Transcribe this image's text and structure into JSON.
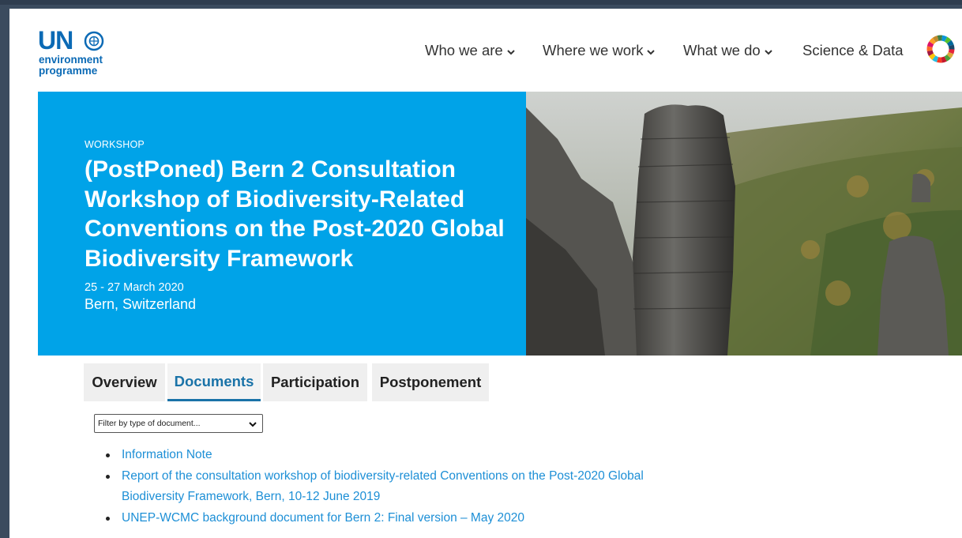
{
  "header": {
    "logo": {
      "un": "UN",
      "line1": "environment",
      "line2": "programme"
    },
    "nav": [
      {
        "label": "Who we are",
        "has_dropdown": true
      },
      {
        "label": "Where we work",
        "has_dropdown": true
      },
      {
        "label": "What we do",
        "has_dropdown": true
      },
      {
        "label": "Science & Data",
        "has_dropdown": false
      }
    ],
    "sdg_icon": "sdg-wheel-icon"
  },
  "hero": {
    "kicker": "WORKSHOP",
    "title": "(PostPoned) Bern 2 Consultation Workshop of Biodiversity-Related Conventions on the Post-2020 Global Biodiversity Framework",
    "date": "25 - 27 March 2020",
    "location": "Bern, Switzerland",
    "background_color": "#00a3e8",
    "image": "sandstone-rock-pillar-forest-photo"
  },
  "tabs": [
    {
      "label": "Overview",
      "active": false
    },
    {
      "label": "Documents",
      "active": true
    },
    {
      "label": "Participation",
      "active": false
    },
    {
      "label": "Postponement",
      "active": false
    }
  ],
  "filter": {
    "selected": "Filter by type of document..."
  },
  "documents": [
    "Information Note",
    "Report of the consultation workshop of biodiversity-related Conventions on the Post-2020 Global Biodiversity Framework, Bern, 10-12 June 2019",
    "UNEP-WCMC background document for Bern 2: Final version – May 2020"
  ],
  "colors": {
    "accent_blue": "#00a3e8",
    "link_blue": "#1d8fd6",
    "active_tab": "#1a73a8",
    "logo_blue": "#0b6ab5"
  }
}
